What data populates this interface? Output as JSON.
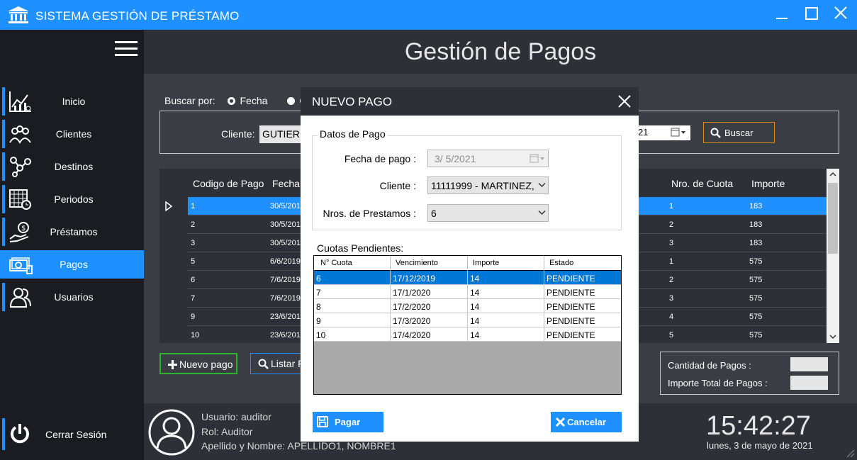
{
  "window": {
    "title": "SISTEMA GESTIÓN DE PRÉSTAMO",
    "minimize": "—",
    "maximize": "☐",
    "close": "✕"
  },
  "sidebar": {
    "items": [
      {
        "label": "Inicio",
        "icon": "chart-icon"
      },
      {
        "label": "Clientes",
        "icon": "clients-icon"
      },
      {
        "label": "Destinos",
        "icon": "network-icon"
      },
      {
        "label": "Periodos",
        "icon": "calendar-icon"
      },
      {
        "label": "Préstamos",
        "icon": "money-hand-icon"
      },
      {
        "label": "Pagos",
        "icon": "cash-icon"
      },
      {
        "label": "Usuarios",
        "icon": "users-icon"
      }
    ],
    "active": "Pagos",
    "logout": "Cerrar Sesión"
  },
  "header": {
    "title": "Gestión de Pagos"
  },
  "search": {
    "label": "Buscar por:",
    "option_fecha": "Fecha",
    "option_cliente_partial": "C",
    "client_label": "Cliente:",
    "client_value": "GUTIERR",
    "date_partial": "21",
    "search_button": "Buscar"
  },
  "grid": {
    "headers": {
      "codigo": "Codigo de Pago",
      "fecha": "Fecha",
      "cuota": "Nro. de Cuota",
      "importe": "Importe"
    },
    "rows": [
      {
        "codigo": "1",
        "fecha": "30/5/201",
        "cuota": "1",
        "importe": "183"
      },
      {
        "codigo": "2",
        "fecha": "30/5/201",
        "cuota": "2",
        "importe": "183"
      },
      {
        "codigo": "3",
        "fecha": "30/5/201",
        "cuota": "3",
        "importe": "183"
      },
      {
        "codigo": "5",
        "fecha": "6/6/2019",
        "cuota": "1",
        "importe": "575"
      },
      {
        "codigo": "6",
        "fecha": "7/6/2019",
        "cuota": "2",
        "importe": "575"
      },
      {
        "codigo": "7",
        "fecha": "7/6/2019",
        "cuota": "3",
        "importe": "575"
      },
      {
        "codigo": "9",
        "fecha": "23/6/201",
        "cuota": "4",
        "importe": "575"
      },
      {
        "codigo": "10",
        "fecha": "23/6/201",
        "cuota": "5",
        "importe": "575"
      }
    ]
  },
  "actions": {
    "nuevo": "Nuevo pago",
    "listar": "Listar P"
  },
  "totals": {
    "cantidad_label": "Cantidad de Pagos :",
    "importe_label": "Importe Total de Pagos :"
  },
  "footer": {
    "usuario": "Usuario: auditor",
    "rol": "Rol: Auditor",
    "nombre": "Apellido y Nombre: APELLIDO1, NOMBRE1",
    "clock": "15:42:27",
    "date": "lunes, 3 de mayo de 2021"
  },
  "modal": {
    "title": "NUEVO PAGO",
    "group_title": "Datos de Pago",
    "fecha_label": "Fecha de pago :",
    "fecha_value": "3/  5/2021",
    "cliente_label": "Cliente :",
    "cliente_value": "11111999 - MARTINEZ,",
    "prestamos_label": "Nros. de Prestamos :",
    "prestamos_value": "6",
    "cuotas_title": "Cuotas Pendientes:",
    "cuotas_headers": {
      "n": "N° Cuota",
      "venc": "Vencimiento",
      "imp": "Importe",
      "estado": "Estado"
    },
    "cuotas": [
      {
        "n": "6",
        "venc": "17/12/2019",
        "imp": "14",
        "estado": "PENDIENTE"
      },
      {
        "n": "7",
        "venc": "17/1/2020",
        "imp": "14",
        "estado": "PENDIENTE"
      },
      {
        "n": "8",
        "venc": "17/2/2020",
        "imp": "14",
        "estado": "PENDIENTE"
      },
      {
        "n": "9",
        "venc": "17/3/2020",
        "imp": "14",
        "estado": "PENDIENTE"
      },
      {
        "n": "10",
        "venc": "17/4/2020",
        "imp": "14",
        "estado": "PENDIENTE"
      }
    ],
    "pagar": "Pagar",
    "cancelar": "Cancelar"
  },
  "colors": {
    "accent": "#1e90ff",
    "sidebar": "#1a1c21",
    "content": "#3a3d44",
    "nuevo_border": "#2ab52a",
    "buscar_border": "#e08a1e"
  }
}
